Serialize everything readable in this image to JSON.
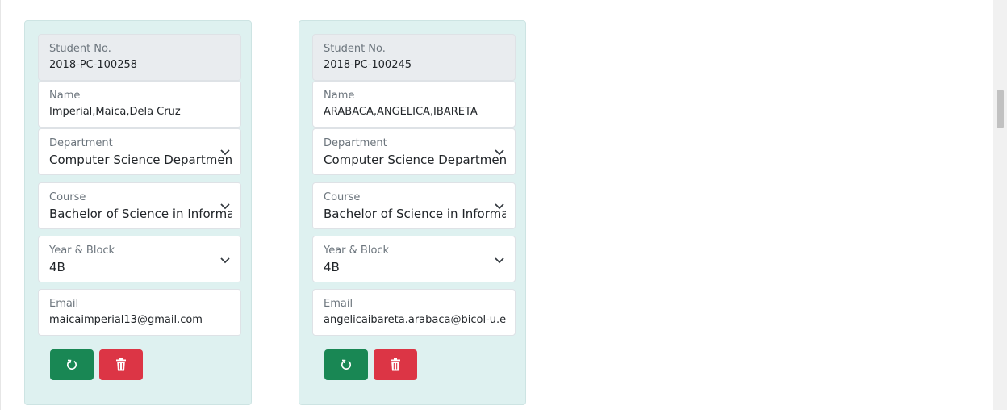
{
  "students": [
    {
      "student_no_label": "Student No.",
      "student_no": "2018-PC-100258",
      "name_label": "Name",
      "name": "Imperial,Maica,Dela Cruz",
      "department_label": "Department",
      "department": "Computer Science Department",
      "course_label": "Course",
      "course": "Bachelor of Science in Information Technology",
      "year_block_label": "Year & Block",
      "year_block": "4B",
      "email_label": "Email",
      "email": "maicaimperial13@gmail.com"
    },
    {
      "student_no_label": "Student No.",
      "student_no": "2018-PC-100245",
      "name_label": "Name",
      "name": "ARABACA,ANGELICA,IBARETA",
      "department_label": "Department",
      "department": "Computer Science Department",
      "course_label": "Course",
      "course": "Bachelor of Science in Information Technology",
      "year_block_label": "Year & Block",
      "year_block": "4B",
      "email_label": "Email",
      "email": "angelicaibareta.arabaca@bicol-u.edu.ph"
    }
  ],
  "icons": {
    "reset": "reset-icon",
    "delete": "trash-icon",
    "select": "chevron-down-icon"
  },
  "colors": {
    "card_bg": "#def1f0",
    "reset_button": "#198754",
    "delete_button": "#dc3545"
  }
}
